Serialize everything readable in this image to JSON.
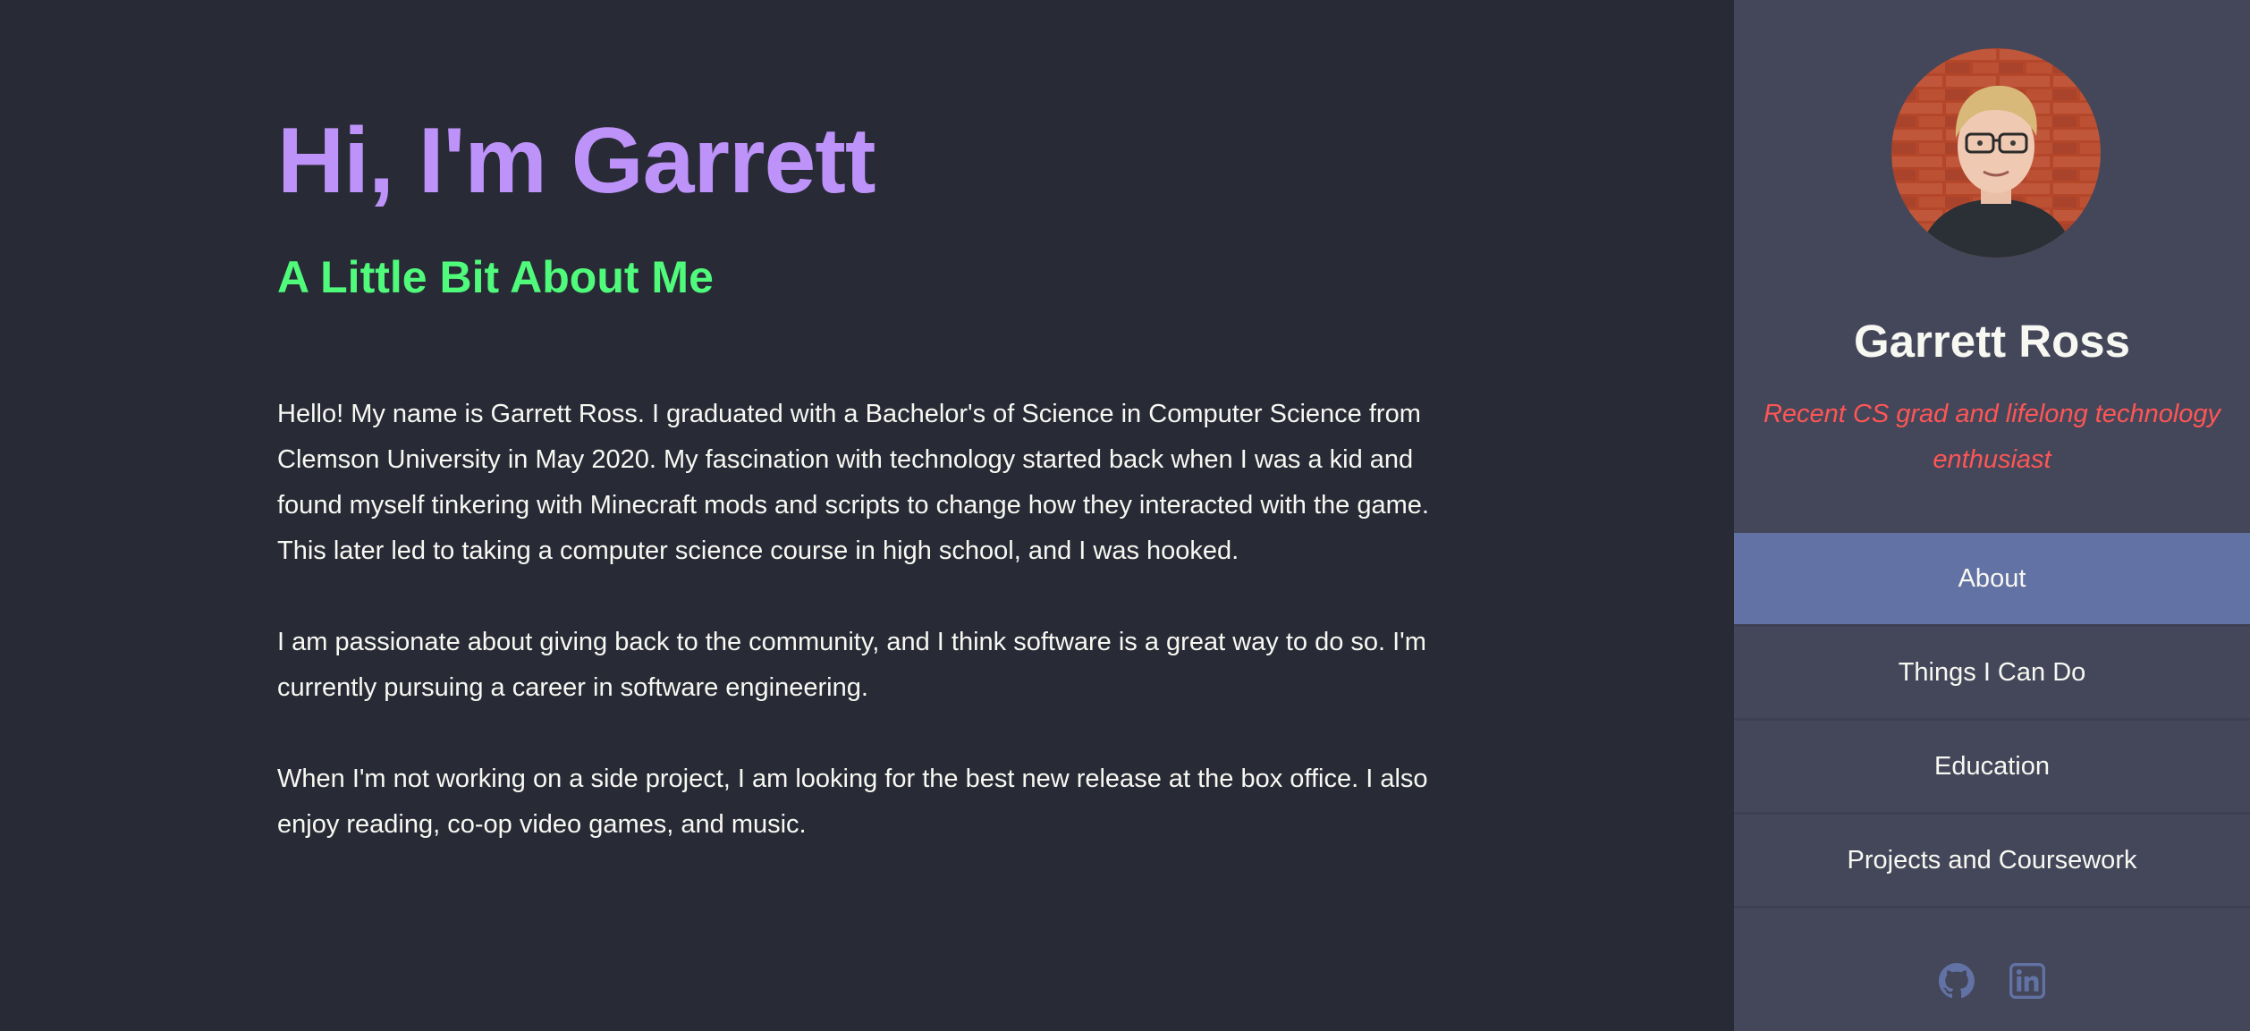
{
  "main": {
    "title": "Hi, I'm Garrett",
    "subtitle": "A Little Bit About Me",
    "paragraphs": [
      "Hello! My name is Garrett Ross. I graduated with a Bachelor's of Science in Computer Science from Clemson University in May 2020. My fascination with technology started back when I was a kid and found myself tinkering with Minecraft mods and scripts to change how they interacted with the game. This later led to taking a computer science course in high school, and I was hooked.",
      "I am passionate about giving back to the community, and I think software is a great way to do so. I'm currently pursuing a career in software engineering.",
      "When I'm not working on a side project, I am looking for the best new release at the box office. I also enjoy reading, co-op video games, and music."
    ]
  },
  "sidebar": {
    "name": "Garrett Ross",
    "tagline": "Recent CS grad and lifelong technology enthusiast",
    "nav": [
      {
        "label": "About",
        "active": true
      },
      {
        "label": "Things I Can Do",
        "active": false
      },
      {
        "label": "Education",
        "active": false
      },
      {
        "label": "Projects and Coursework",
        "active": false
      }
    ],
    "social": [
      {
        "icon": "github-icon"
      },
      {
        "icon": "linkedin-icon"
      }
    ]
  },
  "colors": {
    "background": "#282a36",
    "sidebar": "#44475a",
    "accent_purple": "#bd93f9",
    "accent_green": "#50fa7b",
    "accent_red": "#ff5555",
    "nav_active": "#6272a4"
  }
}
